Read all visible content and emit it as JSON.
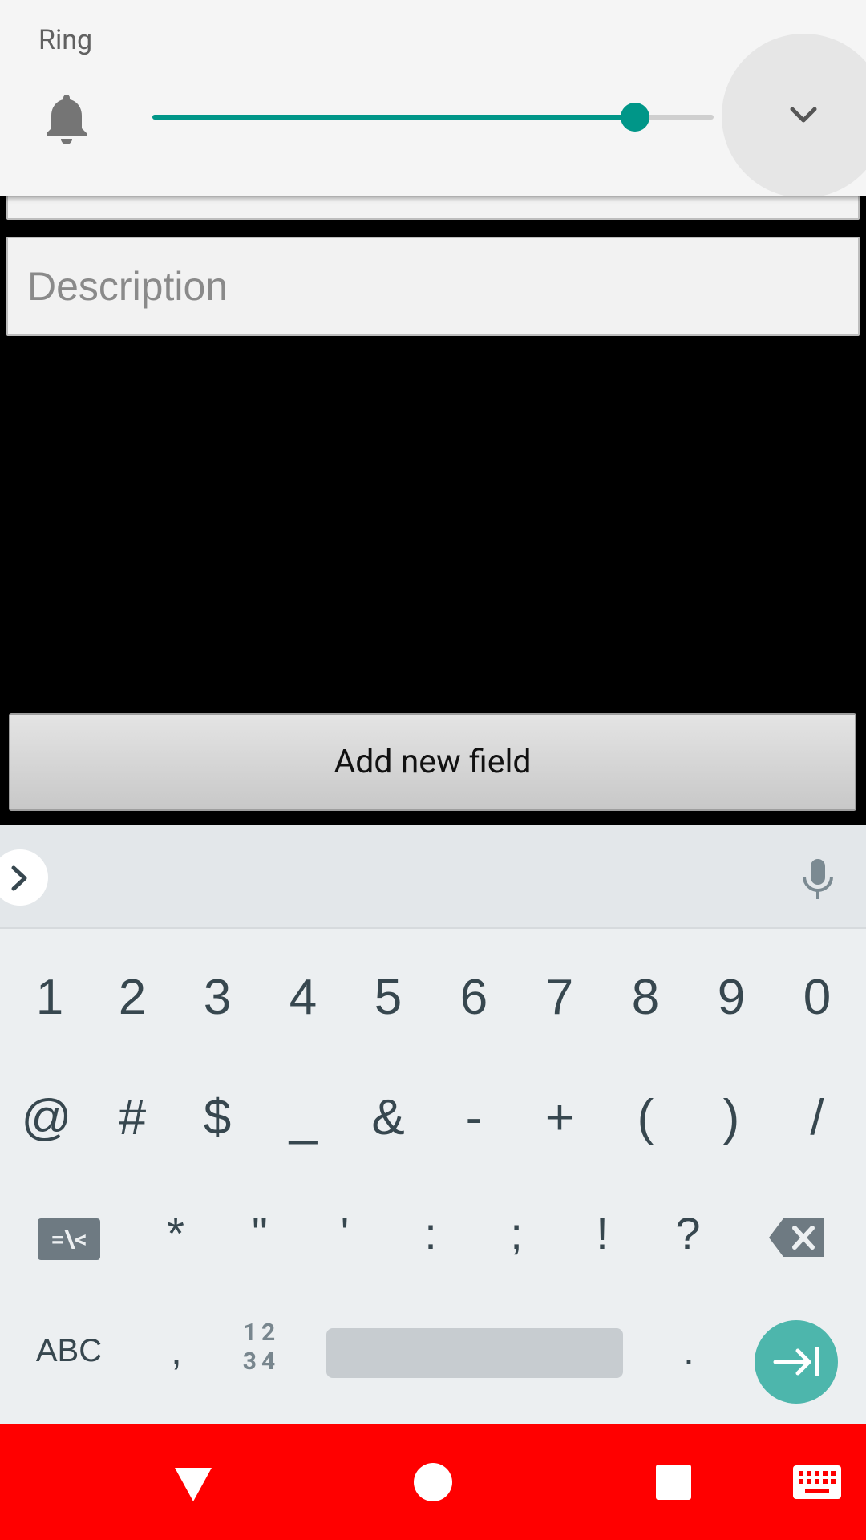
{
  "volume_panel": {
    "title": "Ring",
    "stream_icon": "bell-icon",
    "level_fraction": 0.86,
    "accent_color": "#009688",
    "collapse_icon": "chevron-down-icon"
  },
  "form": {
    "description_placeholder": "Description",
    "add_field_button": "Add new field"
  },
  "keyboard": {
    "suggestion_strip": {
      "expand_icon": "chevron-right-icon",
      "mic_icon": "mic-icon"
    },
    "row1": [
      "1",
      "2",
      "3",
      "4",
      "5",
      "6",
      "7",
      "8",
      "9",
      "0"
    ],
    "row2": [
      "@",
      "#",
      "$",
      "_",
      "&",
      "-",
      "+",
      "(",
      ")",
      "/"
    ],
    "row3": {
      "toggle": "=\\<",
      "keys": [
        "*",
        "\"",
        "'",
        ":",
        ";",
        "!",
        "?"
      ],
      "delete_icon": "backspace-icon"
    },
    "row4": {
      "abc": "ABC",
      "comma": ",",
      "numpad_top": "12",
      "numpad_bottom": "34",
      "period": ".",
      "enter_icon": "tab-next-icon",
      "enter_color": "#4db6ac"
    }
  },
  "navbar": {
    "color": "#ff0000",
    "icons": [
      "back-icon",
      "home-icon",
      "recents-icon",
      "keyboard-icon"
    ]
  }
}
